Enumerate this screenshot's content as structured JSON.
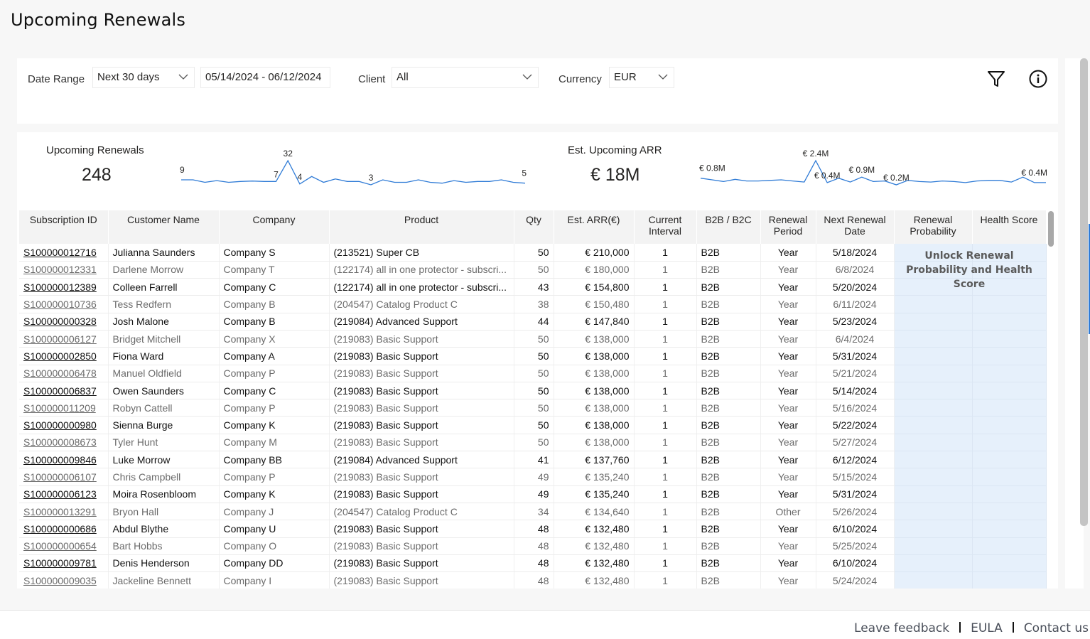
{
  "page": {
    "title": "Upcoming Renewals"
  },
  "filters": {
    "date_range_label": "Date Range",
    "date_range_value": "Next 30 days",
    "date_range_text": "05/14/2024 - 06/12/2024",
    "client_label": "Client",
    "client_value": "All",
    "currency_label": "Currency",
    "currency_value": "EUR",
    "icons": [
      "filter-icon",
      "info-icon"
    ]
  },
  "kpis": {
    "renewals": {
      "label": "Upcoming Renewals",
      "value": "248"
    },
    "arr": {
      "label": "Est. Upcoming ARR",
      "value": "€ 18M"
    }
  },
  "chart_data": [
    {
      "type": "line",
      "title": "Upcoming Renewals (daily)",
      "values": [
        9,
        9,
        6,
        8,
        6,
        7,
        7.5,
        7,
        7,
        32,
        4,
        13,
        6,
        10,
        7,
        7,
        3,
        9,
        6,
        6,
        9,
        6,
        5,
        8,
        6,
        7,
        7,
        9,
        6,
        5
      ],
      "labels": [
        {
          "index": 0,
          "text": "9"
        },
        {
          "index": 8,
          "text": "7"
        },
        {
          "index": 9,
          "text": "32"
        },
        {
          "index": 10,
          "text": "4"
        },
        {
          "index": 16,
          "text": "3"
        },
        {
          "index": 29,
          "text": "5"
        }
      ]
    },
    {
      "type": "line",
      "title": "Est. Upcoming ARR (daily, €M)",
      "values": [
        0.8,
        0.65,
        0.5,
        0.7,
        0.55,
        0.55,
        0.6,
        0.65,
        0.55,
        0.45,
        2.4,
        0.4,
        0.8,
        0.45,
        0.9,
        0.5,
        0.55,
        0.2,
        0.6,
        0.5,
        0.45,
        0.55,
        0.5,
        0.4,
        0.55,
        0.6,
        0.6,
        0.45,
        0.9,
        0.4,
        0.4
      ],
      "labels": [
        {
          "index": 0,
          "text": "€ 0.8M"
        },
        {
          "index": 10,
          "text": "€ 2.4M"
        },
        {
          "index": 11,
          "text": "€ 0.4M"
        },
        {
          "index": 14,
          "text": "€ 0.9M"
        },
        {
          "index": 17,
          "text": "€ 0.2M"
        },
        {
          "index": 30,
          "text": "€ 0.4M"
        }
      ]
    }
  ],
  "table": {
    "columns": [
      "Subscription ID",
      "Customer Name",
      "Company",
      "Product",
      "Qty",
      "Est. ARR(€)",
      "Current Interval",
      "B2B / B2C",
      "Renewal Period",
      "Next Renewal Date",
      "Renewal Probability",
      "Health Score"
    ],
    "locked_message": "Unlock Renewal Probability and Health Score",
    "rows": [
      {
        "id": "S100000012716",
        "name": "Julianna Saunders",
        "company": "Company S",
        "product": "(213521) Super CB",
        "qty": "50",
        "arr": "€ 210,000",
        "interval": "1",
        "type": "B2B",
        "period": "Year",
        "date": "5/18/2024"
      },
      {
        "id": "S100000012331",
        "name": "Darlene Morrow",
        "company": "Company T",
        "product": "(122174) all in one protector - subscri...",
        "qty": "50",
        "arr": "€ 180,000",
        "interval": "1",
        "type": "B2B",
        "period": "Year",
        "date": "6/8/2024"
      },
      {
        "id": "S100000012389",
        "name": "Colleen Farrell",
        "company": "Company C",
        "product": "(122174) all in one protector - subscri...",
        "qty": "43",
        "arr": "€ 154,800",
        "interval": "1",
        "type": "B2B",
        "period": "Year",
        "date": "5/20/2024"
      },
      {
        "id": "S100000010736",
        "name": "Tess Redfern",
        "company": "Company B",
        "product": "(204547) Catalog Product C",
        "qty": "38",
        "arr": "€ 150,480",
        "interval": "1",
        "type": "B2B",
        "period": "Year",
        "date": "6/11/2024"
      },
      {
        "id": "S100000000328",
        "name": "Josh Malone",
        "company": "Company B",
        "product": "(219084) Advanced Support",
        "qty": "44",
        "arr": "€ 147,840",
        "interval": "1",
        "type": "B2B",
        "period": "Year",
        "date": "5/23/2024"
      },
      {
        "id": "S100000006127",
        "name": "Bridget Mitchell",
        "company": "Company X",
        "product": "(219083) Basic Support",
        "qty": "50",
        "arr": "€ 138,000",
        "interval": "1",
        "type": "B2B",
        "period": "Year",
        "date": "6/4/2024"
      },
      {
        "id": "S100000002850",
        "name": "Fiona Ward",
        "company": "Company A",
        "product": "(219083) Basic Support",
        "qty": "50",
        "arr": "€ 138,000",
        "interval": "1",
        "type": "B2B",
        "period": "Year",
        "date": "5/31/2024"
      },
      {
        "id": "S100000006478",
        "name": "Manuel Oldfield",
        "company": "Company P",
        "product": "(219083) Basic Support",
        "qty": "50",
        "arr": "€ 138,000",
        "interval": "1",
        "type": "B2B",
        "period": "Year",
        "date": "5/21/2024"
      },
      {
        "id": "S100000006837",
        "name": "Owen Saunders",
        "company": "Company C",
        "product": "(219083) Basic Support",
        "qty": "50",
        "arr": "€ 138,000",
        "interval": "1",
        "type": "B2B",
        "period": "Year",
        "date": "5/14/2024"
      },
      {
        "id": "S100000011209",
        "name": "Robyn Cattell",
        "company": "Company P",
        "product": "(219083) Basic Support",
        "qty": "50",
        "arr": "€ 138,000",
        "interval": "1",
        "type": "B2B",
        "period": "Year",
        "date": "5/16/2024"
      },
      {
        "id": "S100000000980",
        "name": "Sienna Burge",
        "company": "Company K",
        "product": "(219083) Basic Support",
        "qty": "50",
        "arr": "€ 138,000",
        "interval": "1",
        "type": "B2B",
        "period": "Year",
        "date": "5/22/2024"
      },
      {
        "id": "S100000008673",
        "name": "Tyler Hunt",
        "company": "Company M",
        "product": "(219083) Basic Support",
        "qty": "50",
        "arr": "€ 138,000",
        "interval": "1",
        "type": "B2B",
        "period": "Year",
        "date": "5/27/2024"
      },
      {
        "id": "S100000009846",
        "name": "Luke Morrow",
        "company": "Company BB",
        "product": "(219084) Advanced Support",
        "qty": "41",
        "arr": "€ 137,760",
        "interval": "1",
        "type": "B2B",
        "period": "Year",
        "date": "6/12/2024"
      },
      {
        "id": "S100000006107",
        "name": "Chris Campbell",
        "company": "Company P",
        "product": "(219083) Basic Support",
        "qty": "49",
        "arr": "€ 135,240",
        "interval": "1",
        "type": "B2B",
        "period": "Year",
        "date": "5/15/2024"
      },
      {
        "id": "S100000006123",
        "name": "Moira Rosenbloom",
        "company": "Company K",
        "product": "(219083) Basic Support",
        "qty": "49",
        "arr": "€ 135,240",
        "interval": "1",
        "type": "B2B",
        "period": "Year",
        "date": "5/31/2024"
      },
      {
        "id": "S100000013291",
        "name": "Bryon Hall",
        "company": "Company J",
        "product": "(204547) Catalog Product C",
        "qty": "34",
        "arr": "€ 134,640",
        "interval": "1",
        "type": "B2B",
        "period": "Other",
        "date": "5/26/2024"
      },
      {
        "id": "S100000000686",
        "name": "Abdul Blythe",
        "company": "Company U",
        "product": "(219083) Basic Support",
        "qty": "48",
        "arr": "€ 132,480",
        "interval": "1",
        "type": "B2B",
        "period": "Year",
        "date": "6/10/2024"
      },
      {
        "id": "S100000000654",
        "name": "Bart Hobbs",
        "company": "Company O",
        "product": "(219083) Basic Support",
        "qty": "48",
        "arr": "€ 132,480",
        "interval": "1",
        "type": "B2B",
        "period": "Year",
        "date": "5/25/2024"
      },
      {
        "id": "S100000009781",
        "name": "Denis Henderson",
        "company": "Company DD",
        "product": "(219083) Basic Support",
        "qty": "48",
        "arr": "€ 132,480",
        "interval": "1",
        "type": "B2B",
        "period": "Year",
        "date": "6/10/2024"
      },
      {
        "id": "S100000009035",
        "name": "Jackeline Bennett",
        "company": "Company I",
        "product": "(219083) Basic Support",
        "qty": "48",
        "arr": "€ 132,480",
        "interval": "1",
        "type": "B2B",
        "period": "Year",
        "date": "5/24/2024"
      }
    ]
  },
  "footer": {
    "links": [
      "Leave feedback",
      "EULA",
      "Contact us"
    ]
  },
  "colors": {
    "sparkline": "#2f7bd6",
    "locked_bg": "#e6f0fb"
  }
}
